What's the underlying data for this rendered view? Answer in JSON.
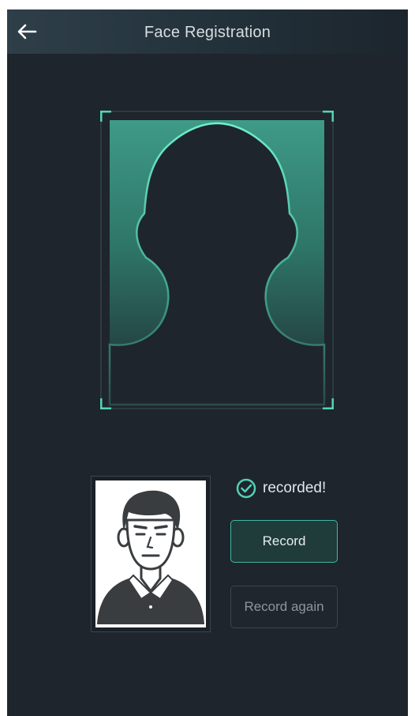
{
  "header": {
    "title": "Face Registration",
    "back_icon": "arrow-left-icon"
  },
  "capture": {
    "frame_icon": "face-outline-silhouette",
    "accent_color": "#5ee0c0"
  },
  "preview": {
    "avatar_icon": "man-portrait-avatar"
  },
  "status": {
    "icon": "check-circle-icon",
    "text": "recorded!"
  },
  "actions": {
    "record_label": "Record",
    "record_again_label": "Record again"
  },
  "colors": {
    "background": "#1f252d",
    "accent": "#3fb8a2",
    "text": "#e2e6e8",
    "muted_text": "#8d969c"
  }
}
